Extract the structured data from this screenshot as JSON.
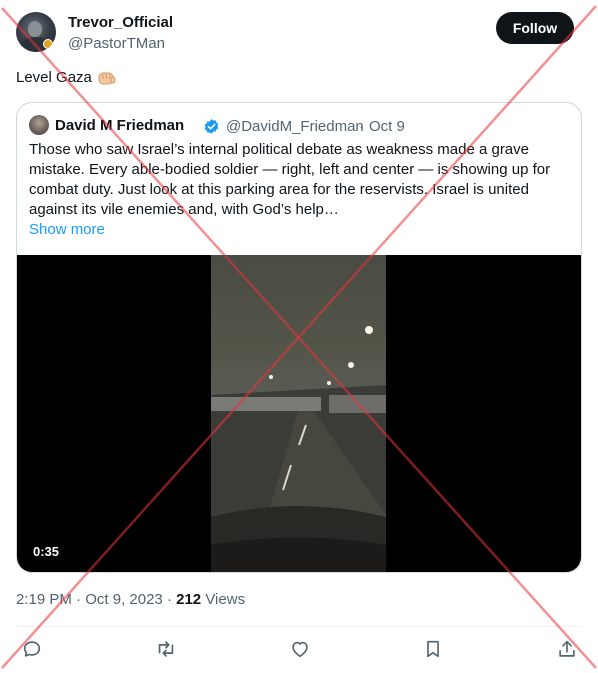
{
  "author": {
    "name": "Trevor_Official",
    "handle": "@PastorTMan",
    "follow_label": "Follow"
  },
  "tweet": {
    "text": "Level Gaza",
    "emoji": "oncoming-fist-emoji"
  },
  "quoted": {
    "name": "David M Friedman",
    "handle": "@DavidM_Friedman",
    "separator": "·",
    "date": "Oct 9",
    "body": "Those who saw Israel’s internal political debate as weakness made a grave mistake. Every able-bodied soldier — right, left and center — is showing up for combat duty. Just look at this parking area for the reservists. Israel is united against its vile enemies and, with God’s help…",
    "show_more": "Show more",
    "video_duration": "0:35"
  },
  "meta": {
    "time": "2:19 PM",
    "separator": "·",
    "date": "Oct 9, 2023",
    "separator2": "·",
    "views_count": "212",
    "views_label": "Views"
  },
  "actions": {
    "icons": [
      "reply-icon",
      "retweet-icon",
      "like-icon",
      "bookmark-icon",
      "share-icon"
    ]
  },
  "colors": {
    "accent": "#1d9bf0",
    "text": "#0f1419",
    "secondary": "#536471",
    "watermark": "#e8343a"
  }
}
